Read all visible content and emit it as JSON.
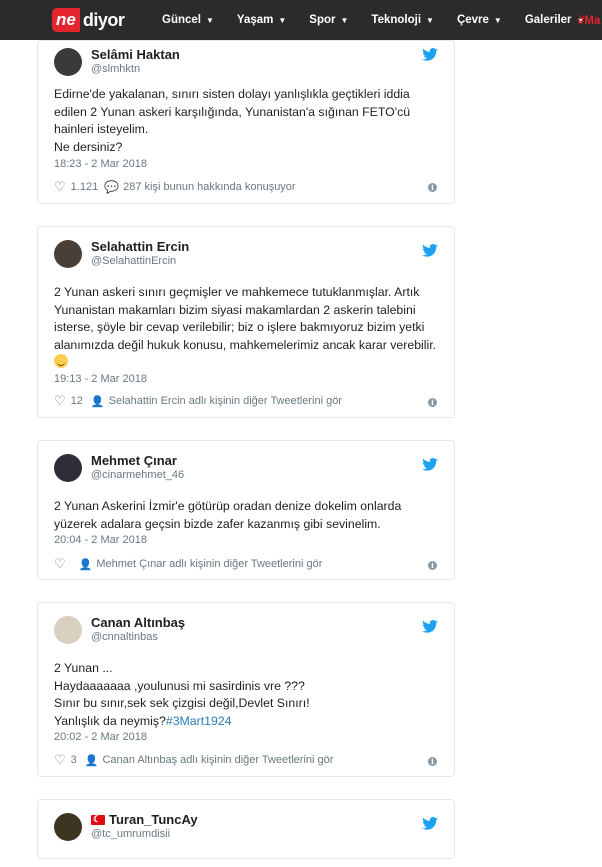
{
  "header": {
    "logo_ne": "ne",
    "logo_diyor": "diyor",
    "nav": [
      "Güncel",
      "Yaşam",
      "Spor",
      "Teknoloji",
      "Çevre",
      "Galeriler"
    ],
    "nav_hash": "#Ma"
  },
  "tweets": [
    {
      "name": "Selâmi Haktan",
      "handle": "@slmhktn",
      "text": "Edirne'de yakalanan, sınırı sisten dolayı yanlışlıkla geçtikleri iddia edilen 2 Yunan askeri karşılığında, Yunanistan'a sığınan FETO'cü hainleri isteyelim.\nNe dersiniz?",
      "time": "18:23 - 2 Mar 2018",
      "likes": "1.121",
      "extra": "287 kişi bunun hakkında konuşuyor"
    },
    {
      "name": "Selahattin Ercin",
      "handle": "@SelahattinErcin",
      "text": "2 Yunan askeri sınırı geçmişler ve mahkemece tutuklanmışlar. Artık Yunanistan makamları bizim siyasi makamlardan 2 askerin talebini isterse, şöyle bir cevap verilebilir; biz o işlere bakmıyoruz bizim yetki alanımızda değil hukuk konusu,  mahkemelerimiz ancak karar verebilir.",
      "time": "19:13 - 2 Mar 2018",
      "likes": "12",
      "extra": "Selahattin Ercin adlı kişinin diğer Tweetlerini gör"
    },
    {
      "name": "Mehmet Çınar",
      "handle": "@cinarmehmet_46",
      "text": "2 Yunan Askerini İzmir'e götürüp oradan denize dokelim onlarda yüzerek adalara geçsin bizde zafer kazanmış gibi sevinelim.",
      "time": "20:04 - 2 Mar 2018",
      "likes": "",
      "extra": "Mehmet Çınar adlı kişinin diğer Tweetlerini gör"
    },
    {
      "name": "Canan Altınbaş",
      "handle": "@cnnaltinbas",
      "text": "2 Yunan ...\nHaydaaaaaaa ,youlunusi mi sasirdinis vre ???\nSınır bu sınır,sek sek çizgisi değil,Devlet Sınırı!\nYanlışlık da neymiş?",
      "hashtag": "#3Mart1924",
      "time": "20:02 - 2 Mar 2018",
      "likes": "3",
      "extra": "Canan Altınbaş adlı kişinin diğer Tweetlerini gör"
    },
    {
      "name": "Turan_TuncAy",
      "handle": "@tc_umrumdisii"
    }
  ],
  "colors": {
    "topbar": "#2b2b2b",
    "brand_red": "#e3262d",
    "twitter_blue": "#1da1f2",
    "meta_gray": "#697882"
  }
}
